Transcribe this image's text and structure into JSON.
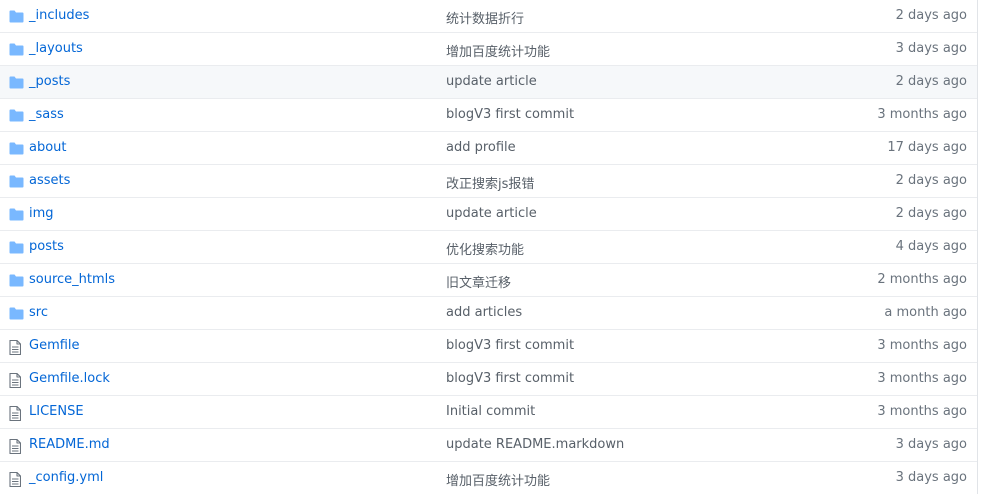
{
  "colors": {
    "link": "#0366d6",
    "message": "#586069",
    "age": "#6a737d",
    "folder_icon": "#79b8ff",
    "file_icon": "#6a737d",
    "row_border": "#eaecef",
    "hover_row": "#f6f8fa"
  },
  "files": [
    {
      "type": "folder",
      "icon": "folder-icon",
      "name": "_includes",
      "message": "统计数据折行",
      "age": "2 days ago"
    },
    {
      "type": "folder",
      "icon": "folder-icon",
      "name": "_layouts",
      "message": "增加百度统计功能",
      "age": "3 days ago"
    },
    {
      "type": "folder",
      "icon": "folder-icon",
      "name": "_posts",
      "message": "update article",
      "age": "2 days ago"
    },
    {
      "type": "folder",
      "icon": "folder-icon",
      "name": "_sass",
      "message": "blogV3 first commit",
      "age": "3 months ago"
    },
    {
      "type": "folder",
      "icon": "folder-icon",
      "name": "about",
      "message": "add profile",
      "age": "17 days ago"
    },
    {
      "type": "folder",
      "icon": "folder-icon",
      "name": "assets",
      "message": "改正搜索js报错",
      "age": "2 days ago"
    },
    {
      "type": "folder",
      "icon": "folder-icon",
      "name": "img",
      "message": "update article",
      "age": "2 days ago"
    },
    {
      "type": "folder",
      "icon": "folder-icon",
      "name": "posts",
      "message": "优化搜索功能",
      "age": "4 days ago"
    },
    {
      "type": "folder",
      "icon": "folder-icon",
      "name": "source_htmls",
      "message": "旧文章迁移",
      "age": "2 months ago"
    },
    {
      "type": "folder",
      "icon": "folder-icon",
      "name": "src",
      "message": "add articles",
      "age": "a month ago"
    },
    {
      "type": "file",
      "icon": "file-icon",
      "name": "Gemfile",
      "message": "blogV3 first commit",
      "age": "3 months ago"
    },
    {
      "type": "file",
      "icon": "file-icon",
      "name": "Gemfile.lock",
      "message": "blogV3 first commit",
      "age": "3 months ago"
    },
    {
      "type": "file",
      "icon": "file-icon",
      "name": "LICENSE",
      "message": "Initial commit",
      "age": "3 months ago"
    },
    {
      "type": "file",
      "icon": "file-icon",
      "name": "README.md",
      "message": "update README.markdown",
      "age": "3 days ago"
    },
    {
      "type": "file",
      "icon": "file-icon",
      "name": "_config.yml",
      "message": "增加百度统计功能",
      "age": "3 days ago"
    }
  ]
}
